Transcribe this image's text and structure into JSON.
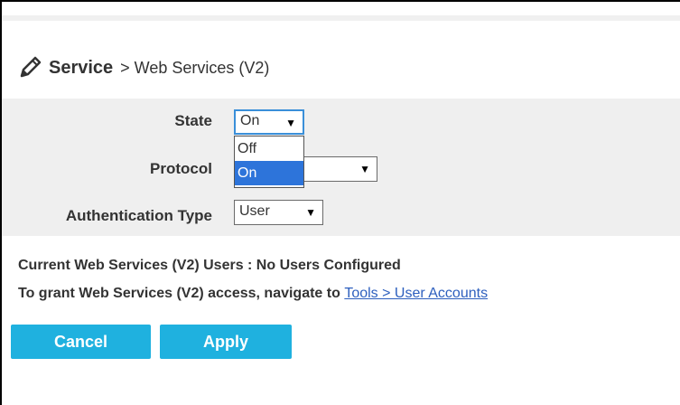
{
  "header": {
    "title": "Service",
    "subtitle": "> Web Services (V2)",
    "icon": "pencil-icon"
  },
  "form": {
    "state": {
      "label": "State",
      "value": "On",
      "options": [
        "Off",
        "On"
      ],
      "selected_option": "On"
    },
    "protocol": {
      "label": "Protocol",
      "value": ""
    },
    "auth_type": {
      "label": "Authentication Type",
      "value": "User"
    },
    "arrow_glyph": "▼"
  },
  "info": {
    "users_line": "Current Web Services (V2) Users : No Users Configured",
    "grant_prefix": "To grant Web Services (V2) access, navigate to",
    "grant_link": "Tools > User Accounts"
  },
  "buttons": {
    "cancel": "Cancel",
    "apply": "Apply"
  },
  "colors": {
    "accent": "#1fb1df",
    "link": "#2d5fbe",
    "selection": "#2d74da",
    "panel": "#efefef"
  }
}
